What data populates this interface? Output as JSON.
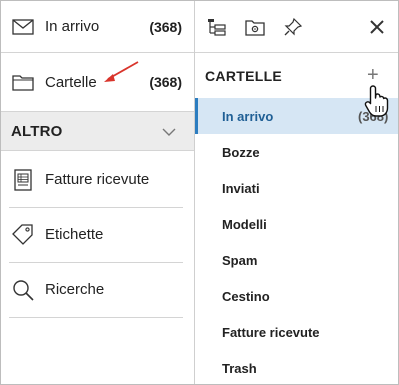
{
  "left": {
    "inbox": {
      "label": "In arrivo",
      "count": "(368)",
      "icon": "envelope-icon"
    },
    "folders": {
      "label": "Cartelle",
      "count": "(368)",
      "icon": "folder-icon"
    },
    "altro": {
      "label": "ALTRO",
      "icon": "chevron-down-icon"
    },
    "items": [
      {
        "label": "Fatture ricevute",
        "icon": "invoice-icon"
      },
      {
        "label": "Etichette",
        "icon": "tag-icon"
      },
      {
        "label": "Ricerche",
        "icon": "search-icon"
      }
    ]
  },
  "toolbar": {
    "icons": [
      "folder-tree-icon",
      "folder-settings-icon",
      "pin-icon",
      "close-icon"
    ]
  },
  "panel": {
    "title": "CARTELLE",
    "add_label": "+",
    "folders": [
      {
        "label": "In arrivo",
        "count": "(368)",
        "active": true
      },
      {
        "label": "Bozze"
      },
      {
        "label": "Inviati"
      },
      {
        "label": "Modelli"
      },
      {
        "label": "Spam"
      },
      {
        "label": "Cestino"
      },
      {
        "label": "Fatture ricevute"
      },
      {
        "label": "Trash"
      }
    ]
  },
  "colors": {
    "active_bg": "#d6e6f4",
    "active_border": "#2c7dc0",
    "annotation_arrow": "#d9342b"
  }
}
